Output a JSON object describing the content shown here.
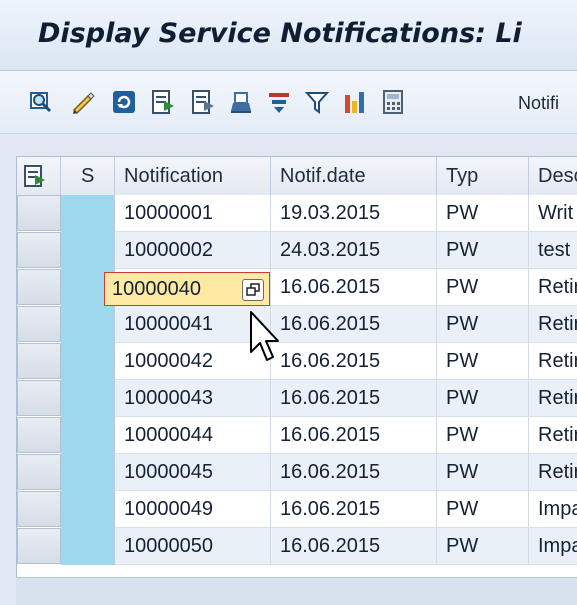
{
  "window": {
    "title": "Display Service Notifications: Li"
  },
  "toolbar": {
    "icons": [
      "details-icon",
      "edit-pencil-icon",
      "refresh-icon",
      "export-list-icon",
      "export-list-2-icon",
      "print-icon",
      "sort-icon",
      "filter-icon",
      "chart-icon",
      "calculator-icon"
    ],
    "trailing_label": "Notifi"
  },
  "table": {
    "headers": {
      "s": "S",
      "notification": "Notification",
      "notif_date": "Notif.date",
      "typ": "Typ",
      "desc": "Desc"
    },
    "rows": [
      {
        "notification": "10000001",
        "notif_date": "19.03.2015",
        "typ": "PW",
        "desc": "Writ"
      },
      {
        "notification": "10000002",
        "notif_date": "24.03.2015",
        "typ": "PW",
        "desc": "test"
      },
      {
        "notification": "10000040",
        "notif_date": "16.06.2015",
        "typ": "PW",
        "desc": "Retir"
      },
      {
        "notification": "10000041",
        "notif_date": "16.06.2015",
        "typ": "PW",
        "desc": "Retir"
      },
      {
        "notification": "10000042",
        "notif_date": "16.06.2015",
        "typ": "PW",
        "desc": "Retir"
      },
      {
        "notification": "10000043",
        "notif_date": "16.06.2015",
        "typ": "PW",
        "desc": "Retir"
      },
      {
        "notification": "10000044",
        "notif_date": "16.06.2015",
        "typ": "PW",
        "desc": "Retir"
      },
      {
        "notification": "10000045",
        "notif_date": "16.06.2015",
        "typ": "PW",
        "desc": "Retir"
      },
      {
        "notification": "10000049",
        "notif_date": "16.06.2015",
        "typ": "PW",
        "desc": "Impa"
      },
      {
        "notification": "10000050",
        "notif_date": "16.06.2015",
        "typ": "PW",
        "desc": "Impa"
      }
    ],
    "selected_row_index": 2
  },
  "colors": {
    "status_column": "#9ed8ee",
    "focus_cell_bg": "#fde9a2",
    "focus_border": "#d23a3a"
  }
}
